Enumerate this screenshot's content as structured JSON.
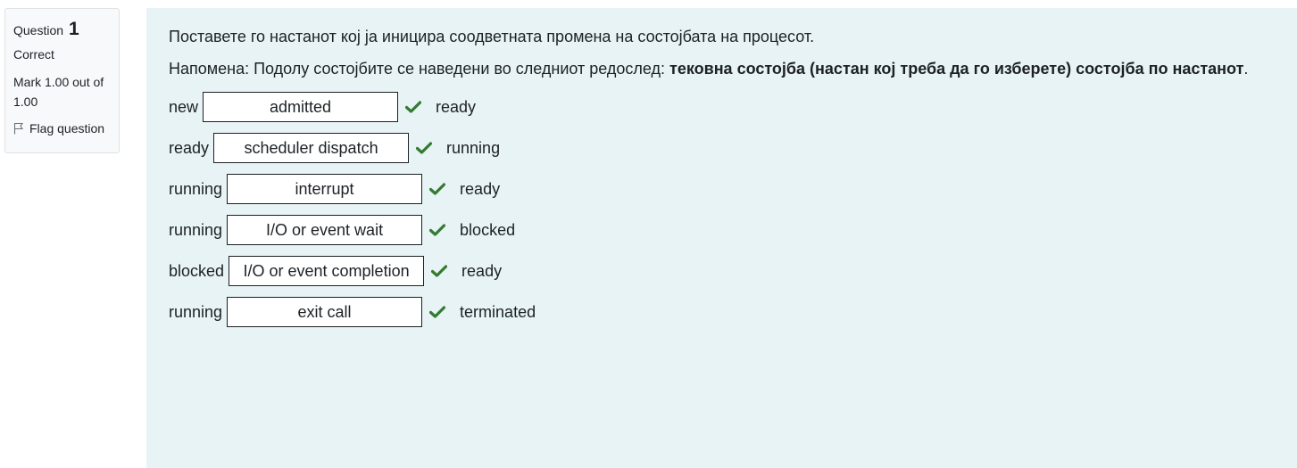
{
  "info": {
    "question_label": "Question",
    "question_number": "1",
    "state": "Correct",
    "grade": "Mark 1.00 out of 1.00",
    "flag_label": "Flag question"
  },
  "question": {
    "prompt": "Поставете го настанот кој ја иницира соодветната промена на состојбата на процесот.",
    "note_prefix": "Напомена: Подолу состојбите се наведени во следниот редослед: ",
    "note_bold": "тековна состојба (настан кој треба да го изберете) состојба по настанот",
    "note_suffix": ".",
    "rows": [
      {
        "from": "new",
        "answer": "admitted",
        "to": "ready",
        "status": "correct"
      },
      {
        "from": "ready",
        "answer": "scheduler dispatch",
        "to": "running",
        "status": "correct"
      },
      {
        "from": "running",
        "answer": "interrupt",
        "to": "ready",
        "status": "correct"
      },
      {
        "from": "running",
        "answer": "I/O or event wait",
        "to": "blocked",
        "status": "correct"
      },
      {
        "from": "blocked",
        "answer": "I/O or event completion",
        "to": "ready",
        "status": "correct"
      },
      {
        "from": "running",
        "answer": "exit call",
        "to": "terminated",
        "status": "correct"
      }
    ]
  },
  "colors": {
    "content_bg": "#e7f3f5",
    "info_bg": "#f8f9fa",
    "correct": "#357a32"
  },
  "icons": {
    "flag": "flag-icon",
    "correct": "check-icon"
  }
}
